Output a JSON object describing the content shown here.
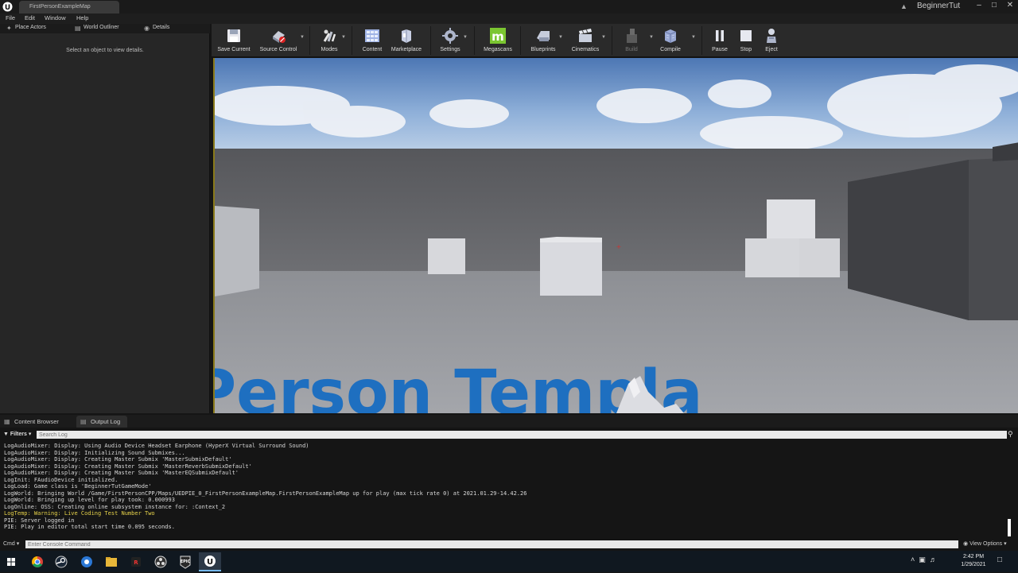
{
  "window": {
    "map_tab": "FirstPersonExampleMap",
    "project_name": "BeginnerTut"
  },
  "menu": [
    "File",
    "Edit",
    "Window",
    "Help"
  ],
  "left_panel": {
    "tabs": [
      "Place Actors",
      "World Outliner",
      "Details"
    ],
    "details_message": "Select an object to view details."
  },
  "toolbar": {
    "buttons": [
      {
        "label": "Save Current",
        "icon": "save-icon"
      },
      {
        "label": "Source Control",
        "icon": "source-control-icon"
      },
      {
        "label": "Modes",
        "icon": "modes-icon"
      },
      {
        "label": "Content",
        "icon": "content-icon"
      },
      {
        "label": "Marketplace",
        "icon": "marketplace-icon"
      },
      {
        "label": "Settings",
        "icon": "settings-icon"
      },
      {
        "label": "Megascans",
        "icon": "megascans-icon"
      },
      {
        "label": "Blueprints",
        "icon": "blueprints-icon"
      },
      {
        "label": "Cinematics",
        "icon": "cinematics-icon"
      },
      {
        "label": "Build",
        "icon": "build-icon"
      },
      {
        "label": "Compile",
        "icon": "compile-icon"
      },
      {
        "label": "Pause",
        "icon": "pause-icon"
      },
      {
        "label": "Stop",
        "icon": "stop-icon"
      },
      {
        "label": "Eject",
        "icon": "eject-icon"
      }
    ]
  },
  "viewport": {
    "floor_text": "Person Templa"
  },
  "bottom_tabs": [
    "Content Browser",
    "Output Log"
  ],
  "log": {
    "filters_label": "Filters",
    "search_placeholder": "Search Log",
    "lines": [
      {
        "text": "LogAudioMixer: Display: Using Audio Device Headset Earphone (HyperX Virtual Surround Sound)",
        "level": "normal"
      },
      {
        "text": "LogAudioMixer: Display: Initializing Sound Submixes...",
        "level": "normal"
      },
      {
        "text": "LogAudioMixer: Display: Creating Master Submix 'MasterSubmixDefault'",
        "level": "normal"
      },
      {
        "text": "LogAudioMixer: Display: Creating Master Submix 'MasterReverbSubmixDefault'",
        "level": "normal"
      },
      {
        "text": "LogAudioMixer: Display: Creating Master Submix 'MasterEQSubmixDefault'",
        "level": "normal"
      },
      {
        "text": "LogInit: FAudioDevice initialized.",
        "level": "normal"
      },
      {
        "text": "LogLoad: Game class is 'BeginnerTutGameMode'",
        "level": "normal"
      },
      {
        "text": "LogWorld: Bringing World /Game/FirstPersonCPP/Maps/UEDPIE_0_FirstPersonExampleMap.FirstPersonExampleMap up for play (max tick rate 0) at 2021.01.29-14.42.26",
        "level": "normal"
      },
      {
        "text": "LogWorld: Bringing up level for play took: 0.000993",
        "level": "normal"
      },
      {
        "text": "LogOnline: OSS: Creating online subsystem instance for: :Context_2",
        "level": "normal"
      },
      {
        "text": "LogTemp: Warning: Live Coding Test Number Two",
        "level": "warning"
      },
      {
        "text": "PIE: Server logged in",
        "level": "normal"
      },
      {
        "text": "PIE: Play in editor total start time 0.095 seconds.",
        "level": "normal"
      }
    ],
    "cmd_label": "Cmd",
    "cmd_placeholder": "Enter Console Command",
    "view_options": "View Options"
  },
  "taskbar": {
    "time": "2:42 PM",
    "date": "1/29/2021"
  },
  "colors": {
    "warning": "#e6d24a",
    "floor_text": "#1e6fc0",
    "active_taskbar": "#76b9ed"
  }
}
